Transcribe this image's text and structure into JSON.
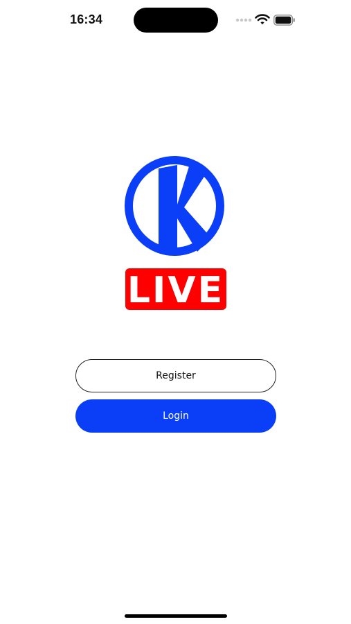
{
  "status_bar": {
    "time": "16:34",
    "icons": [
      "cellular-signal-icon",
      "wifi-icon",
      "battery-icon"
    ]
  },
  "logo": {
    "letter": "K",
    "badge_text": "LIVE",
    "colors": {
      "circle": "#0a3ff7",
      "badge": "#ff0000"
    }
  },
  "actions": {
    "register_label": "Register",
    "login_label": "Login"
  },
  "colors": {
    "primary": "#0a3ff7",
    "background": "#ffffff",
    "text": "#111111"
  }
}
